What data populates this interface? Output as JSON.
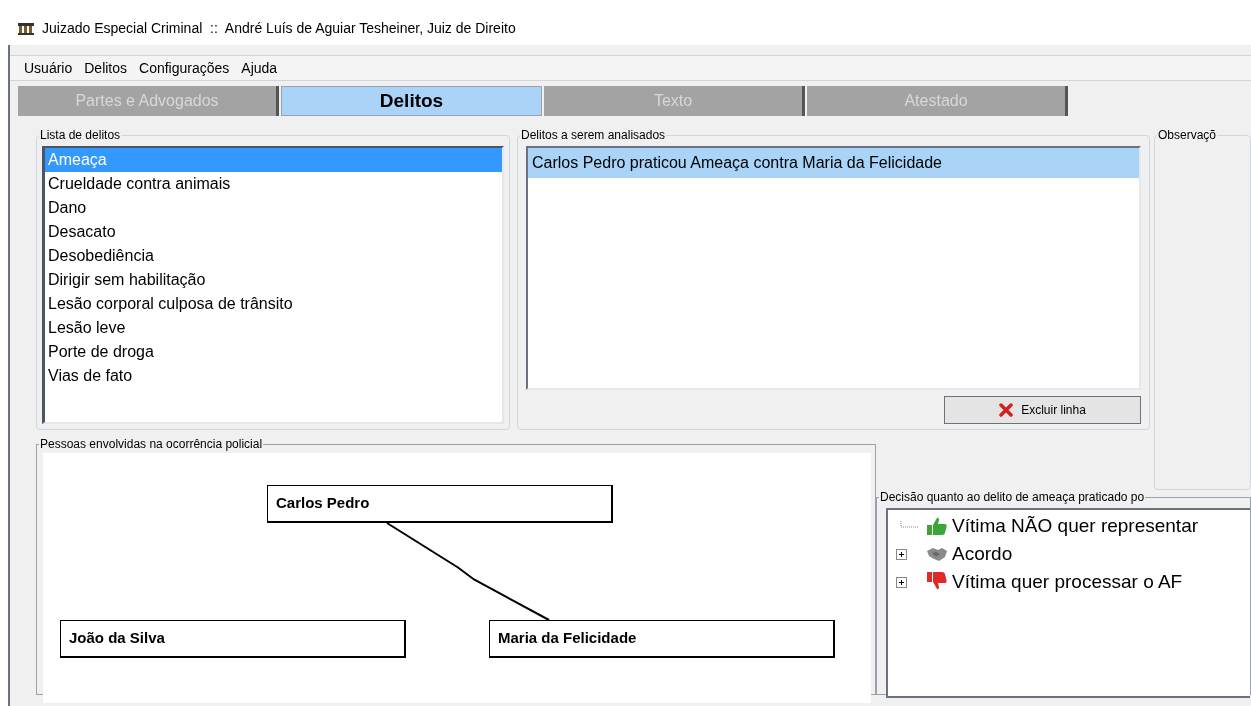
{
  "window": {
    "title": "Juizado Especial Criminal  ::  André Luís de Aguiar Tesheiner, Juiz de Direito"
  },
  "menu": [
    "Usuário",
    "Delitos",
    "Configurações",
    "Ajuda"
  ],
  "tabs": [
    {
      "label": "Partes e Advogados",
      "selected": false
    },
    {
      "label": "Delitos",
      "selected": true
    },
    {
      "label": "Texto",
      "selected": false
    },
    {
      "label": "Atestado",
      "selected": false
    }
  ],
  "offense_list": {
    "title": "Lista de delitos",
    "items": [
      {
        "label": "Ameaça",
        "selected": true
      },
      {
        "label": "Crueldade contra animais",
        "selected": false
      },
      {
        "label": "Dano",
        "selected": false
      },
      {
        "label": "Desacato",
        "selected": false
      },
      {
        "label": "Desobediência",
        "selected": false
      },
      {
        "label": "Dirigir sem habilitação",
        "selected": false
      },
      {
        "label": "Lesão corporal culposa de trânsito",
        "selected": false
      },
      {
        "label": "Lesão leve",
        "selected": false
      },
      {
        "label": "Porte de droga",
        "selected": false
      },
      {
        "label": "Vias de fato",
        "selected": false
      }
    ]
  },
  "analysis": {
    "title": "Delitos a serem analisados",
    "items": [
      {
        "label": "Carlos Pedro praticou Ameaça contra Maria da Felicidade",
        "selected": true
      }
    ],
    "button": "Excluir linha"
  },
  "observations": {
    "title": "Observaçõ"
  },
  "people": {
    "title": "Pessoas envolvidas na ocorrência policial",
    "nodes": [
      {
        "name": "Carlos Pedro",
        "kind": "offender"
      },
      {
        "name": "João da Silva",
        "kind": "bystander"
      },
      {
        "name": "Maria da Felicidade",
        "kind": "victim"
      }
    ]
  },
  "decision": {
    "title": "Decisão quanto ao delito de ameaça praticado po",
    "items": [
      {
        "label": "Vítima NÃO quer representar",
        "kind": "approve",
        "expandable": false
      },
      {
        "label": "Acordo",
        "kind": "agreement",
        "expandable": true
      },
      {
        "label": "Vítima quer processar o AF",
        "kind": "reject",
        "expandable": true
      }
    ]
  }
}
